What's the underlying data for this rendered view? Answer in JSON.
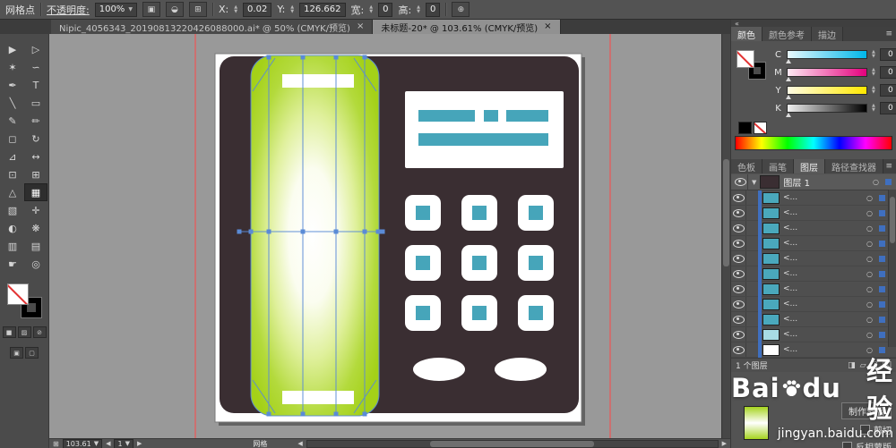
{
  "colors": {
    "ui-bg": "#535353",
    "canvas-bg": "#999999",
    "accent-teal": "#46a5ba",
    "phone-body": "#3a2e32",
    "handset-green": "#a6d41f",
    "mesh-blue": "#5a8bd6",
    "guide-red": "#ff4848",
    "selection-blue": "#3f6fbf"
  },
  "icons": {
    "panel_menu": "≡",
    "collapse": "«",
    "disclosure": "▼",
    "target": "○",
    "close": "×",
    "dropdown": "▼",
    "up": "▲",
    "down": "▼",
    "arrow_left": "◀",
    "arrow_right": "▶",
    "grid": "⊞"
  },
  "control_bar": {
    "context_label": "网格点",
    "opacity_label": "不透明度:",
    "opacity_value": "100%",
    "x_label": "X:",
    "x_value": "0.02",
    "y_label": "Y:",
    "y_value": "126.662",
    "w_label": "宽:",
    "w_value": "0",
    "h_label": "高:",
    "h_value": "0"
  },
  "tabs": [
    {
      "label": "Nipic_4056343_20190813220426088000.ai* @ 50% (CMYK/预览)"
    },
    {
      "label": "未标题-20* @ 103.61% (CMYK/预览)"
    }
  ],
  "tools": [
    {
      "name": "selection-tool",
      "glyph": "▶"
    },
    {
      "name": "direct-selection-tool",
      "glyph": "▷"
    },
    {
      "name": "magic-wand-tool",
      "glyph": "✶"
    },
    {
      "name": "lasso-tool",
      "glyph": "∽"
    },
    {
      "name": "pen-tool",
      "glyph": "✒"
    },
    {
      "name": "type-tool",
      "glyph": "T"
    },
    {
      "name": "line-segment-tool",
      "glyph": "╲"
    },
    {
      "name": "rectangle-tool",
      "glyph": "▭"
    },
    {
      "name": "paintbrush-tool",
      "glyph": "✎"
    },
    {
      "name": "pencil-tool",
      "glyph": "✏"
    },
    {
      "name": "eraser-tool",
      "glyph": "◻"
    },
    {
      "name": "rotate-tool",
      "glyph": "↻"
    },
    {
      "name": "scale-tool",
      "glyph": "⊿"
    },
    {
      "name": "width-tool",
      "glyph": "↔"
    },
    {
      "name": "free-transform-tool",
      "glyph": "⊡"
    },
    {
      "name": "shape-builder-tool",
      "glyph": "⊞"
    },
    {
      "name": "perspective-grid-tool",
      "glyph": "△"
    },
    {
      "name": "mesh-tool",
      "glyph": "▦"
    },
    {
      "name": "gradient-tool",
      "glyph": "▧"
    },
    {
      "name": "eyedropper-tool",
      "glyph": "✛"
    },
    {
      "name": "blend-tool",
      "glyph": "◐"
    },
    {
      "name": "symbol-sprayer-tool",
      "glyph": "❋"
    },
    {
      "name": "column-graph-tool",
      "glyph": "▥"
    },
    {
      "name": "artboard-tool",
      "glyph": "▤"
    },
    {
      "name": "hand-tool",
      "glyph": "☛"
    },
    {
      "name": "zoom-tool",
      "glyph": "◎"
    }
  ],
  "color_panel": {
    "tab_color": "颜色",
    "tab_guide": "颜色参考",
    "tab_stroke": "描边",
    "channels": [
      {
        "label": "C",
        "value": "0"
      },
      {
        "label": "M",
        "value": "0"
      },
      {
        "label": "Y",
        "value": "0"
      },
      {
        "label": "K",
        "value": "0"
      }
    ]
  },
  "panels": {
    "tab_swatches": "色板",
    "tab_brushes": "画笔",
    "tab_layers": "图层",
    "tab_pathfinder": "路径查找器"
  },
  "layers": {
    "group_label": "图层 1",
    "rows": [
      {
        "label": "<..."
      },
      {
        "label": "<..."
      },
      {
        "label": "<..."
      },
      {
        "label": "<..."
      },
      {
        "label": "<..."
      },
      {
        "label": "<..."
      },
      {
        "label": "<..."
      },
      {
        "label": "<..."
      },
      {
        "label": "<..."
      },
      {
        "label": "<..."
      },
      {
        "label": "<..."
      }
    ],
    "footer": "1 个图层"
  },
  "transparency": {
    "make_mask": "制作蒙版",
    "clip": "剪切",
    "invert": "反相蒙版"
  },
  "watermark": {
    "prefix": "Bai",
    "suffix": "du",
    "cn": "经验",
    "url": "jingyan.baidu.com"
  },
  "status_bar": {
    "zoom": "103.61",
    "artboard": "1",
    "tool_name": "网格"
  }
}
